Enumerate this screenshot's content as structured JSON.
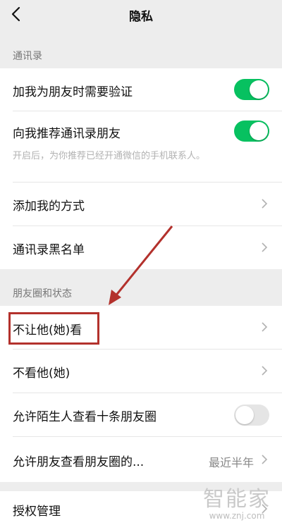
{
  "header": {
    "title": "隐私"
  },
  "section_contacts": {
    "label": "通讯录"
  },
  "rows": {
    "verify": {
      "label": "加我为朋友时需要验证",
      "toggle": true
    },
    "recommend": {
      "label": "向我推荐通讯录朋友",
      "toggle": true,
      "subtext": "开启后，为你推荐已经开通微信的手机联系人。"
    },
    "add_methods": {
      "label": "添加我的方式"
    },
    "blacklist": {
      "label": "通讯录黑名单"
    },
    "hide_from": {
      "label": "不让他(她)看"
    },
    "dont_see": {
      "label": "不看他(她)"
    },
    "strangers": {
      "label": "允许陌生人查看十条朋友圈",
      "toggle": false
    },
    "moments_range": {
      "label": "允许朋友查看朋友圈的...",
      "value": "最近半年"
    },
    "authorization": {
      "label": "授权管理"
    }
  },
  "section_moments": {
    "label": "朋友圈和状态"
  },
  "watermark": {
    "brand": "智能家",
    "url": "www.znj.com"
  },
  "colors": {
    "toggle_on": "#07c160",
    "highlight": "#b3312c"
  }
}
